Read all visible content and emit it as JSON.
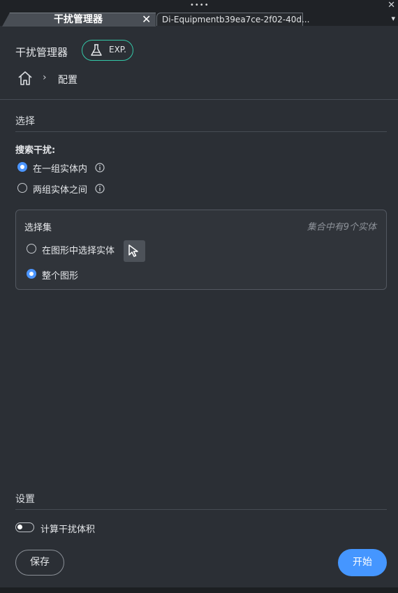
{
  "window": {
    "grip": "••••",
    "close_glyph": "✕"
  },
  "tabs": [
    {
      "label": "干扰管理器",
      "active": true,
      "close_glyph": "✕"
    },
    {
      "label": "Di-Equipmentb39ea7ce-2f02-40d...",
      "active": false
    }
  ],
  "tab_menu_glyph": "▾",
  "header": {
    "title": "干扰管理器",
    "badge": {
      "label": "EXP.",
      "icon": "flask-icon",
      "color": "#34c8a8"
    }
  },
  "breadcrumb": {
    "home_icon": "home-icon",
    "separator": "›",
    "current": "配置"
  },
  "selection_section": {
    "heading": "选择",
    "search_label": "搜索干扰:",
    "search_options": [
      {
        "label": "在一组实体内",
        "selected": true
      },
      {
        "label": "两组实体之间",
        "selected": false
      }
    ],
    "selection_set": {
      "title": "选择集",
      "count_text": "集合中有9个实体",
      "options": [
        {
          "label": "在图形中选择实体",
          "selected": false,
          "icon": "pointer-select-icon"
        },
        {
          "label": "整个图形",
          "selected": true
        }
      ]
    }
  },
  "settings_section": {
    "heading": "设置",
    "toggle_label": "计算干扰体积",
    "toggle_on": false
  },
  "buttons": {
    "save": "保存",
    "start": "开始"
  },
  "colors": {
    "accent": "#4596ff",
    "badge": "#34c8a8",
    "background": "#2b2f35"
  }
}
